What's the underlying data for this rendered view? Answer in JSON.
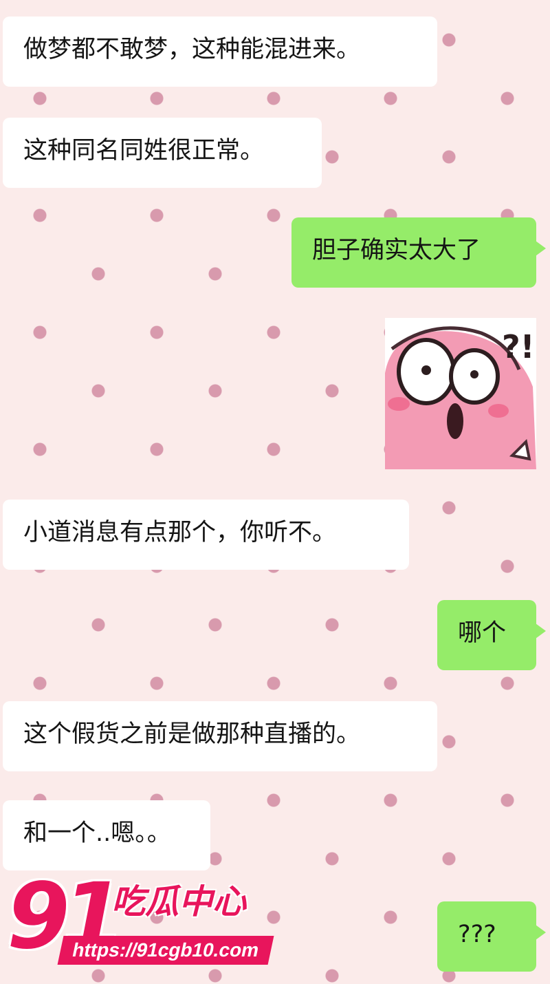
{
  "messages": [
    {
      "side": "in",
      "text": "做梦都不敢梦，这种能混进来。"
    },
    {
      "side": "in",
      "text": "这种同名同姓很正常。"
    },
    {
      "side": "out",
      "text": "胆子确实太大了"
    },
    {
      "side": "out",
      "type": "sticker",
      "icon": "surprised-pink-face-sticker",
      "text": "?!"
    },
    {
      "side": "in",
      "text": "小道消息有点那个，你听不。"
    },
    {
      "side": "out",
      "text": "哪个"
    },
    {
      "side": "in",
      "text": "这个假货之前是做那种直播的。"
    },
    {
      "side": "in",
      "text": "和一个..嗯。。"
    },
    {
      "side": "out",
      "text": "???"
    }
  ],
  "watermark": {
    "number": "91",
    "name": "吃瓜中心",
    "url": "https://91cgb10.com"
  },
  "colors": {
    "background": "#fbebea",
    "dot": "#d89aad",
    "incoming_bubble": "#ffffff",
    "outgoing_bubble": "#95ec69",
    "watermark": "#e8155c"
  }
}
